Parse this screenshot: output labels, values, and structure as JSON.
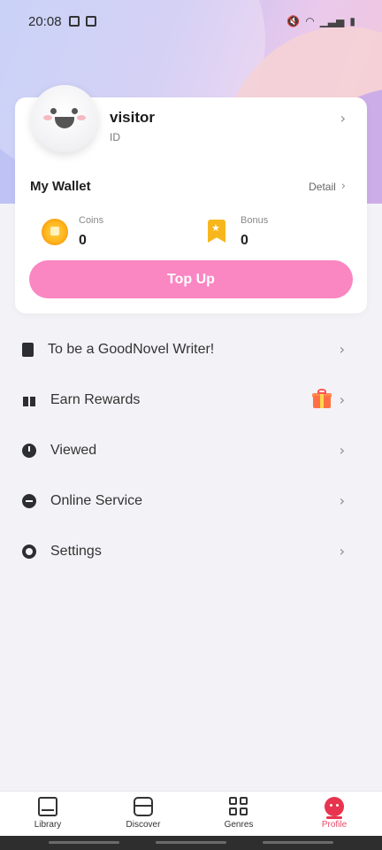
{
  "status_bar": {
    "time": "20:08",
    "icons": [
      "notification-icon",
      "image-icon",
      "mute-icon",
      "wifi-icon",
      "signal-icon",
      "battery-icon"
    ]
  },
  "profile": {
    "username": "visitor",
    "id_label": "ID"
  },
  "wallet": {
    "title": "My Wallet",
    "detail_label": "Detail",
    "coins_label": "Coins",
    "coins_value": "0",
    "bonus_label": "Bonus",
    "bonus_value": "0",
    "topup_label": "Top Up",
    "topup_color": "#fa86c2"
  },
  "menu": [
    {
      "label": "To be a GoodNovel Writer!",
      "icon": "writer-icon"
    },
    {
      "label": "Earn Rewards",
      "icon": "gift-icon"
    },
    {
      "label": "Viewed",
      "icon": "clock-icon"
    },
    {
      "label": "Online Service",
      "icon": "chat-icon"
    },
    {
      "label": "Settings",
      "icon": "gear-icon"
    }
  ],
  "bottom_nav": {
    "items": [
      {
        "label": "Library"
      },
      {
        "label": "Discover"
      },
      {
        "label": "Genres"
      },
      {
        "label": "Profile",
        "active": true
      }
    ],
    "active_color": "#e94b6b"
  }
}
